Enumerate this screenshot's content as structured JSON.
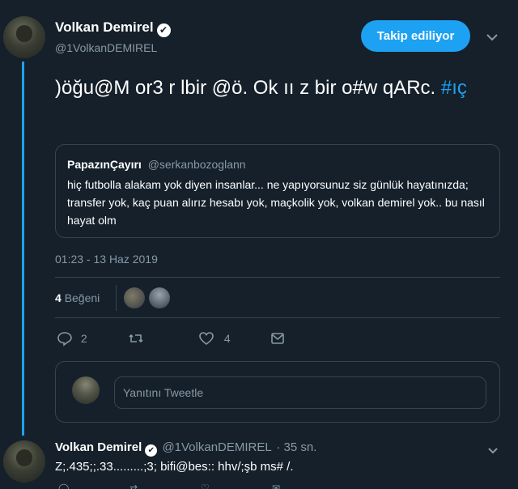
{
  "main_tweet": {
    "author_name": "Volkan Demirel",
    "verified_mark": "✔",
    "handle": "@1VolkanDEMIREL",
    "follow_label": "Takip ediliyor",
    "text": ")öğu@M or3 r lbir @ö. Ok ıı z bir o#w qARc.",
    "hashtag": "#ıç",
    "quoted": {
      "name": "PapazınÇayırı",
      "handle": "@serkanbozoglann",
      "text": "hiç futbolla alakam yok diyen insanlar... ne yapıyorsunuz siz günlük hayatınızda; transfer yok, kaç puan alırız hesabı yok, maçkolik yok, volkan demirel yok.. bu nasıl hayat olm"
    },
    "timestamp": "01:23 - 13 Haz 2019",
    "likes_count": "4",
    "likes_label": "Beğeni",
    "actions": {
      "reply_count": "2",
      "retweet_count": "",
      "like_count": "4"
    },
    "reply_placeholder": "Yanıtını Tweetle"
  },
  "reply_tweet": {
    "author_name": "Volkan Demirel",
    "handle": "@1VolkanDEMIREL",
    "time": "· 35 sn.",
    "text": "Z;.435;;.33.........;3; bifi@bes::  hhv/;şb ms#  /."
  },
  "icons": [
    "avatar",
    "verified-icon",
    "chevron-down-icon",
    "reply-icon",
    "retweet-icon",
    "heart-icon",
    "message-icon"
  ],
  "colors": {
    "background": "#15202b",
    "accent": "#1da1f2",
    "secondary_text": "#8899a6",
    "border": "#38444d"
  }
}
